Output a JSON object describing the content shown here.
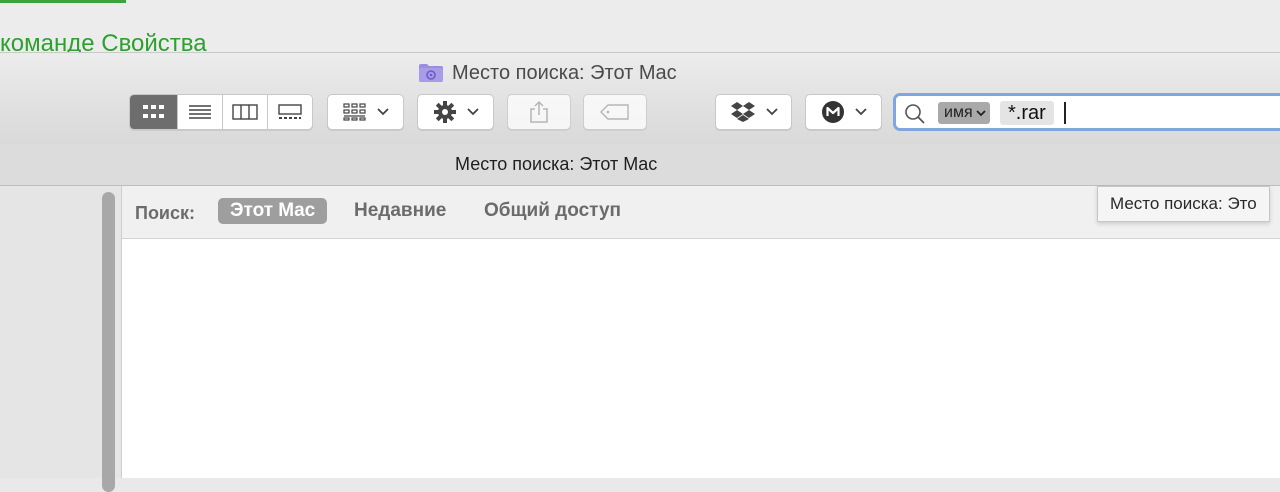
{
  "background": {
    "text": "команде Свойства",
    "text_color": "#2ea02f"
  },
  "window": {
    "title": "Место поиска: Этот Mac",
    "title_icon": "smart-folder-icon"
  },
  "toolbar": {
    "view_modes": [
      "icon-view-icon",
      "list-view-icon",
      "column-view-icon",
      "gallery-view-icon"
    ],
    "active_view": "icon-view",
    "group_button_icon": "group-by-icon",
    "action_button_icon": "gear-icon",
    "share_button_icon": "share-icon",
    "tags_button_icon": "tag-icon",
    "dropbox_button_icon": "dropbox-icon",
    "mega_button_icon": "mega-icon"
  },
  "search": {
    "token_kind": "имя",
    "token_value": "*.rar",
    "border_color": "#7ea6e0"
  },
  "pathbar": {
    "text": "Место поиска: Этот Mac"
  },
  "scope": {
    "label": "Поиск:",
    "items": [
      "Этот Mac",
      "Недавние",
      "Общий доступ"
    ],
    "active_index": 0
  },
  "tooltip": {
    "text": "Место поиска: Это"
  }
}
